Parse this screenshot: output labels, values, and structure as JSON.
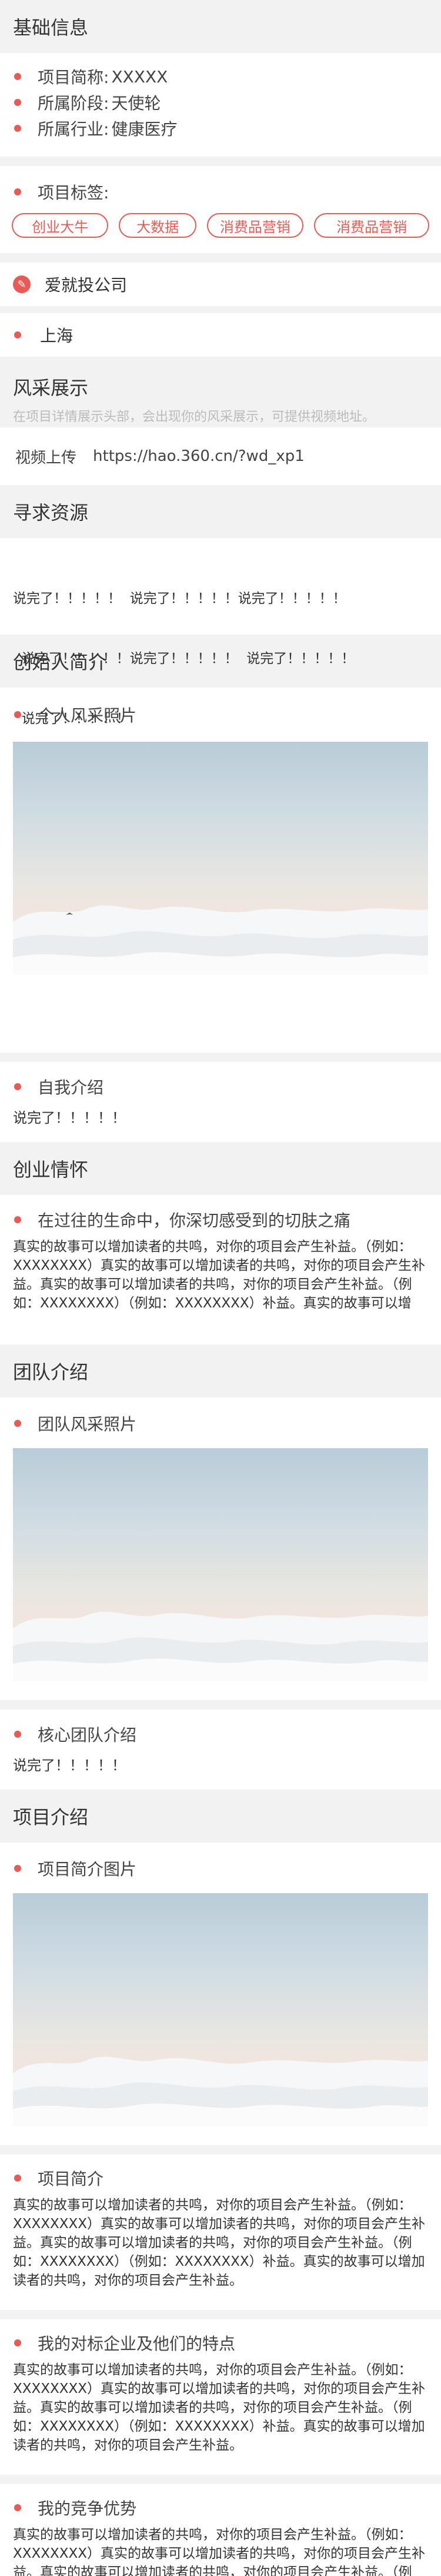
{
  "basic": {
    "title": "基础信息",
    "short_name_label": "项目简称:",
    "short_name_value": "XXXXX",
    "stage_label": "所属阶段:",
    "stage_value": "天使轮",
    "industry_label": "所属行业:",
    "industry_value": "健康医疗"
  },
  "tags": {
    "label": "项目标签:",
    "items": [
      "创业大牛",
      "大数据",
      "消费品营销",
      "消费品营销"
    ]
  },
  "company": {
    "name": "爱就投公司",
    "city": "上海"
  },
  "showcase": {
    "title": "风采展示",
    "hint": "在项目详情展示头部，会出现你的风采展示，可提供视频地址。",
    "video_label": "视频上传",
    "video_url": "https://hao.360.cn/?wd_xp1"
  },
  "resources": {
    "title": "寻求资源",
    "lines": [
      "说完了！！！！！  说完了！！！！！说完了！！！！！",
      "  说完了！！！！！说完了！！！！！  说完了！！！！！",
      "  说完了！！！！！"
    ]
  },
  "founder": {
    "title": "创始人简介",
    "photo_label": "个人风采照片",
    "intro_label": "自我介绍",
    "intro_text": "说完了！！！！！"
  },
  "story": {
    "title": "创业情怀",
    "question": "在过往的生命中，你深切感受到的切肤之痛",
    "text": "真实的故事可以增加读者的共鸣，对你的项目会产生补益。（例如：XXXXXXXX）真实的故事可以增加读者的共鸣，对你的项目会产生补益。真实的故事可以增加读者的共鸣，对你的项目会产生补益。（例如：XXXXXXXX）（例如：XXXXXXXX）补益。真实的故事可以增"
  },
  "team": {
    "title": "团队介绍",
    "photo_label": "团队风采照片",
    "core_label": "核心团队介绍",
    "core_text": "说完了！！！！！"
  },
  "project": {
    "title": "项目介绍",
    "photo_label": "项目简介图片",
    "summary_label": "项目简介",
    "summary_text": "真实的故事可以增加读者的共鸣，对你的项目会产生补益。（例如：XXXXXXXX）真实的故事可以增加读者的共鸣，对你的项目会产生补益。真实的故事可以增加读者的共鸣，对你的项目会产生补益。（例如：XXXXXXXX）（例如：XXXXXXXX）补益。真实的故事可以增加读者的共鸣，对你的项目会产生补益。",
    "benchmark_label": "我的对标企业及他们的特点",
    "benchmark_text": "真实的故事可以增加读者的共鸣，对你的项目会产生补益。（例如：XXXXXXXX）真实的故事可以增加读者的共鸣，对你的项目会产生补益。真实的故事可以增加读者的共鸣，对你的项目会产生补益。（例如：XXXXXXXX）（例如：XXXXXXXX）补益。真实的故事可以增加读者的共鸣，对你的项目会产生补益。",
    "advantage_label": "我的竞争优势",
    "advantage_text": "真实的故事可以增加读者的共鸣，对你的项目会产生补益。（例如：XXXXXXXX）真实的故事可以增加读者的共鸣，对你的项目会产生补益。真实的故事可以增加读者的共鸣，对你的项目会产生补益。（例如：XXXXXXXX）（例如："
  },
  "colors": {
    "accent": "#ea5a55",
    "section_bg": "#f2f2f2",
    "text": "#333333"
  },
  "icons": {
    "bullet": "red-dot-icon",
    "company": "pencil-icon",
    "location": "red-dot-icon"
  }
}
